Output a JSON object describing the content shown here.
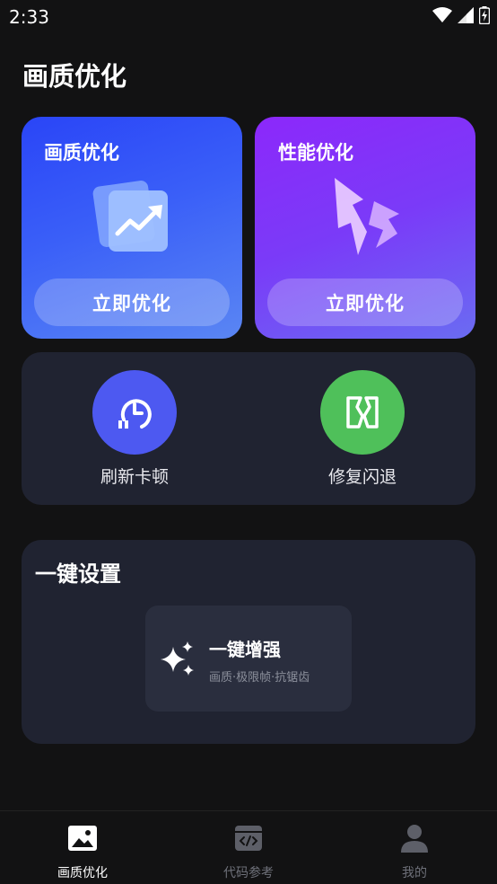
{
  "status_bar": {
    "time": "2:33"
  },
  "page": {
    "title": "画质优化"
  },
  "cards": [
    {
      "title": "画质优化",
      "button_label": "立即优化",
      "icon": "trend-chart-icon"
    },
    {
      "title": "性能优化",
      "button_label": "立即优化",
      "icon": "lightning-icon"
    }
  ],
  "tools": [
    {
      "label": "刷新卡顿",
      "icon": "clock-refresh-icon",
      "color": "#4d59f1"
    },
    {
      "label": "修复闪退",
      "icon": "repair-icon",
      "color": "#4fc05a"
    }
  ],
  "one_click": {
    "title": "一键设置",
    "enhance_title": "一键增强",
    "enhance_subtitle": "画质·极限帧·抗锯齿",
    "icon": "sparkle-icon"
  },
  "bottom_nav": {
    "items": [
      {
        "label": "画质优化",
        "icon": "image-icon",
        "active": true
      },
      {
        "label": "代码参考",
        "icon": "code-icon",
        "active": false
      },
      {
        "label": "我的",
        "icon": "person-icon",
        "active": false
      }
    ]
  }
}
